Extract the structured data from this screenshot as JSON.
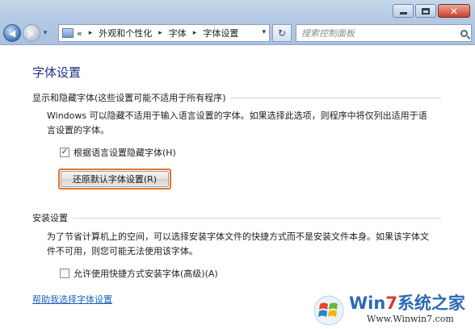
{
  "window": {
    "minimize_icon": "minimize-icon",
    "maximize_icon": "maximize-icon",
    "close_icon": "close-icon"
  },
  "nav": {
    "back_icon": "back-arrow-icon",
    "forward_icon": "forward-arrow-icon",
    "dropdown_icon": "chevron-down-icon"
  },
  "address": {
    "overflow": "«",
    "breadcrumb": [
      "外观和个性化",
      "字体",
      "字体设置"
    ],
    "separator": "▸",
    "dropdown": "▾"
  },
  "search": {
    "placeholder": "搜索控制面板"
  },
  "page": {
    "title": "字体设置",
    "section1": {
      "heading": "显示和隐藏字体(这些设置可能不适用于所有程序)",
      "description": "Windows 可以隐藏不适用于输入语言设置的字体。如果选择此选项，则程序中将仅列出适用于语言设置的字体。",
      "checkbox_label": "根据语言设置隐藏字体(H)",
      "checkbox_checked": true,
      "button_label": "还原默认字体设置(R)"
    },
    "section2": {
      "heading": "安装设置",
      "description": "为了节省计算机上的空间，可以选择安装字体文件的快捷方式而不是安装文件本身。如果该字体文件不可用，则您可能无法使用该字体。",
      "checkbox_label": "允许使用快捷方式安装字体(高级)(A)",
      "checkbox_checked": false
    },
    "help_link": "帮助我选择字体设置"
  },
  "watermark": {
    "brand_prefix": "Win",
    "brand_number": "7",
    "brand_suffix": "系统之家",
    "url": "Www.Winwin7.com"
  },
  "colors": {
    "accent": "#1e3287",
    "link": "#1c63b8",
    "focus_border": "#e2762a"
  }
}
